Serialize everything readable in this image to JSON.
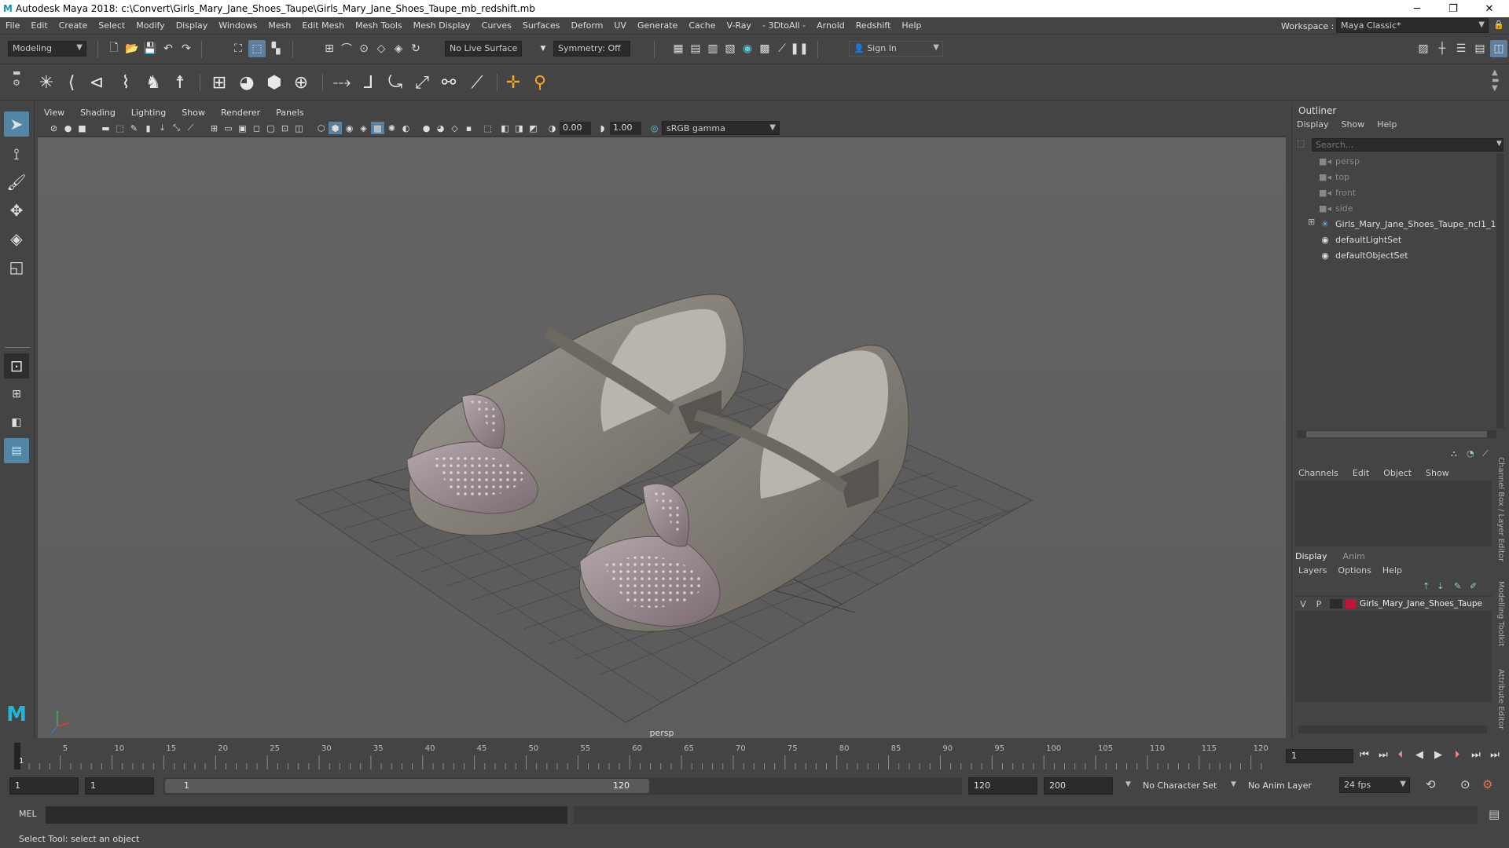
{
  "window": {
    "title": "Autodesk Maya 2018: c:\\Convert\\Girls_Mary_Jane_Shoes_Taupe\\Girls_Mary_Jane_Shoes_Taupe_mb_redshift.mb",
    "app_icon": "M",
    "minimize": "─",
    "maximize": "❐",
    "close": "✕"
  },
  "menubar": {
    "items": [
      "File",
      "Edit",
      "Create",
      "Select",
      "Modify",
      "Display",
      "Windows",
      "Mesh",
      "Edit Mesh",
      "Mesh Tools",
      "Mesh Display",
      "Curves",
      "Surfaces",
      "Deform",
      "UV",
      "Generate",
      "Cache",
      "V-Ray",
      "- 3DtoAll -",
      "Arnold",
      "Redshift",
      "Help"
    ],
    "workspace_label": "Workspace :",
    "workspace_value": "Maya Classic*"
  },
  "statusline": {
    "mode": "Modeling",
    "live_surface": "No Live Surface",
    "symmetry": "Symmetry: Off",
    "sign_in": "Sign In"
  },
  "viewport": {
    "menu": [
      "View",
      "Shading",
      "Lighting",
      "Show",
      "Renderer",
      "Panels"
    ],
    "exposure": "0.00",
    "gamma": "1.00",
    "color_space": "sRGB gamma",
    "camera_label": "persp"
  },
  "outliner": {
    "title": "Outliner",
    "menu": [
      "Display",
      "Show",
      "Help"
    ],
    "search_placeholder": "Search...",
    "items": [
      {
        "label": "persp",
        "icon": "camera-icon",
        "dim": true
      },
      {
        "label": "top",
        "icon": "camera-icon",
        "dim": true
      },
      {
        "label": "front",
        "icon": "camera-icon",
        "dim": true
      },
      {
        "label": "side",
        "icon": "camera-icon",
        "dim": true
      },
      {
        "label": "Girls_Mary_Jane_Shoes_Taupe_ncl1_1",
        "icon": "transform-icon",
        "dim": false
      },
      {
        "label": "defaultLightSet",
        "icon": "set-icon",
        "dim": false
      },
      {
        "label": "defaultObjectSet",
        "icon": "set-icon",
        "dim": false
      }
    ]
  },
  "channelbox": {
    "menu": [
      "Channels",
      "Edit",
      "Object",
      "Show"
    ]
  },
  "layer_editor": {
    "tabs": [
      "Display",
      "Anim"
    ],
    "menu": [
      "Layers",
      "Options",
      "Help"
    ],
    "layer": {
      "v": "V",
      "p": "P",
      "name": "Girls_Mary_Jane_Shoes_Taupe",
      "color": "#c0143c"
    }
  },
  "side_tabs": [
    "Channel Box / Layer Editor",
    "Modelling Toolkit",
    "Attribute Editor"
  ],
  "timeline": {
    "ticks": [
      "5",
      "10",
      "15",
      "20",
      "25",
      "30",
      "35",
      "40",
      "45",
      "50",
      "55",
      "60",
      "65",
      "70",
      "75",
      "80",
      "85",
      "90",
      "95",
      "100",
      "105",
      "110",
      "115",
      "120"
    ],
    "current_frame_marker": "1",
    "current_frame": "1"
  },
  "range": {
    "start": "1",
    "anim_start": "1",
    "slider_start": "1",
    "slider_end": "120",
    "end": "120",
    "anim_end": "200",
    "character_set": "No Character Set",
    "anim_layer": "No Anim Layer",
    "fps": "24 fps"
  },
  "command": {
    "lang": "MEL"
  },
  "help_line": "Select Tool: select an object"
}
